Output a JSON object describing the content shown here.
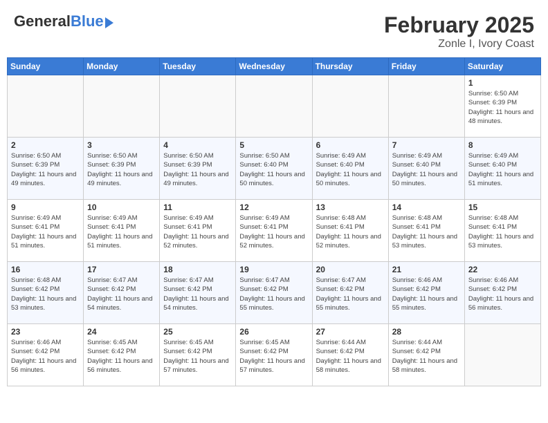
{
  "header": {
    "logo_general": "General",
    "logo_blue": "Blue",
    "month_year": "February 2025",
    "location": "Zonle I, Ivory Coast"
  },
  "calendar": {
    "days_of_week": [
      "Sunday",
      "Monday",
      "Tuesday",
      "Wednesday",
      "Thursday",
      "Friday",
      "Saturday"
    ],
    "weeks": [
      [
        {
          "day": "",
          "info": ""
        },
        {
          "day": "",
          "info": ""
        },
        {
          "day": "",
          "info": ""
        },
        {
          "day": "",
          "info": ""
        },
        {
          "day": "",
          "info": ""
        },
        {
          "day": "",
          "info": ""
        },
        {
          "day": "1",
          "info": "Sunrise: 6:50 AM\nSunset: 6:39 PM\nDaylight: 11 hours and 48 minutes."
        }
      ],
      [
        {
          "day": "2",
          "info": "Sunrise: 6:50 AM\nSunset: 6:39 PM\nDaylight: 11 hours and 49 minutes."
        },
        {
          "day": "3",
          "info": "Sunrise: 6:50 AM\nSunset: 6:39 PM\nDaylight: 11 hours and 49 minutes."
        },
        {
          "day": "4",
          "info": "Sunrise: 6:50 AM\nSunset: 6:39 PM\nDaylight: 11 hours and 49 minutes."
        },
        {
          "day": "5",
          "info": "Sunrise: 6:50 AM\nSunset: 6:40 PM\nDaylight: 11 hours and 50 minutes."
        },
        {
          "day": "6",
          "info": "Sunrise: 6:49 AM\nSunset: 6:40 PM\nDaylight: 11 hours and 50 minutes."
        },
        {
          "day": "7",
          "info": "Sunrise: 6:49 AM\nSunset: 6:40 PM\nDaylight: 11 hours and 50 minutes."
        },
        {
          "day": "8",
          "info": "Sunrise: 6:49 AM\nSunset: 6:40 PM\nDaylight: 11 hours and 51 minutes."
        }
      ],
      [
        {
          "day": "9",
          "info": "Sunrise: 6:49 AM\nSunset: 6:41 PM\nDaylight: 11 hours and 51 minutes."
        },
        {
          "day": "10",
          "info": "Sunrise: 6:49 AM\nSunset: 6:41 PM\nDaylight: 11 hours and 51 minutes."
        },
        {
          "day": "11",
          "info": "Sunrise: 6:49 AM\nSunset: 6:41 PM\nDaylight: 11 hours and 52 minutes."
        },
        {
          "day": "12",
          "info": "Sunrise: 6:49 AM\nSunset: 6:41 PM\nDaylight: 11 hours and 52 minutes."
        },
        {
          "day": "13",
          "info": "Sunrise: 6:48 AM\nSunset: 6:41 PM\nDaylight: 11 hours and 52 minutes."
        },
        {
          "day": "14",
          "info": "Sunrise: 6:48 AM\nSunset: 6:41 PM\nDaylight: 11 hours and 53 minutes."
        },
        {
          "day": "15",
          "info": "Sunrise: 6:48 AM\nSunset: 6:41 PM\nDaylight: 11 hours and 53 minutes."
        }
      ],
      [
        {
          "day": "16",
          "info": "Sunrise: 6:48 AM\nSunset: 6:42 PM\nDaylight: 11 hours and 53 minutes."
        },
        {
          "day": "17",
          "info": "Sunrise: 6:47 AM\nSunset: 6:42 PM\nDaylight: 11 hours and 54 minutes."
        },
        {
          "day": "18",
          "info": "Sunrise: 6:47 AM\nSunset: 6:42 PM\nDaylight: 11 hours and 54 minutes."
        },
        {
          "day": "19",
          "info": "Sunrise: 6:47 AM\nSunset: 6:42 PM\nDaylight: 11 hours and 55 minutes."
        },
        {
          "day": "20",
          "info": "Sunrise: 6:47 AM\nSunset: 6:42 PM\nDaylight: 11 hours and 55 minutes."
        },
        {
          "day": "21",
          "info": "Sunrise: 6:46 AM\nSunset: 6:42 PM\nDaylight: 11 hours and 55 minutes."
        },
        {
          "day": "22",
          "info": "Sunrise: 6:46 AM\nSunset: 6:42 PM\nDaylight: 11 hours and 56 minutes."
        }
      ],
      [
        {
          "day": "23",
          "info": "Sunrise: 6:46 AM\nSunset: 6:42 PM\nDaylight: 11 hours and 56 minutes."
        },
        {
          "day": "24",
          "info": "Sunrise: 6:45 AM\nSunset: 6:42 PM\nDaylight: 11 hours and 56 minutes."
        },
        {
          "day": "25",
          "info": "Sunrise: 6:45 AM\nSunset: 6:42 PM\nDaylight: 11 hours and 57 minutes."
        },
        {
          "day": "26",
          "info": "Sunrise: 6:45 AM\nSunset: 6:42 PM\nDaylight: 11 hours and 57 minutes."
        },
        {
          "day": "27",
          "info": "Sunrise: 6:44 AM\nSunset: 6:42 PM\nDaylight: 11 hours and 58 minutes."
        },
        {
          "day": "28",
          "info": "Sunrise: 6:44 AM\nSunset: 6:42 PM\nDaylight: 11 hours and 58 minutes."
        },
        {
          "day": "",
          "info": ""
        }
      ]
    ]
  }
}
